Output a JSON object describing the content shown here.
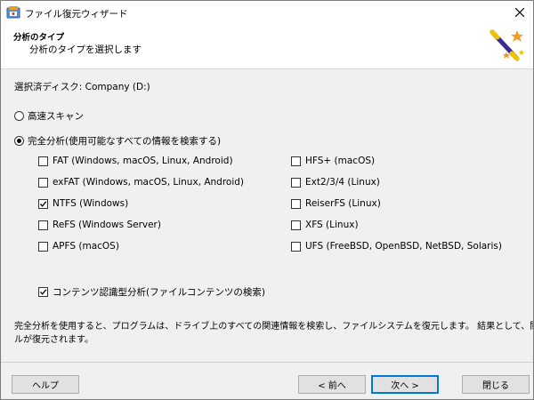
{
  "window": {
    "title": "ファイル復元ウィザード"
  },
  "header": {
    "title": "分析のタイプ",
    "subtitle": "分析のタイプを選択します"
  },
  "selected_disk": "選択済ディスク: Company (D:)",
  "options": {
    "quick_scan": {
      "label": "高速スキャン",
      "checked": false
    },
    "full_analysis": {
      "label": "完全分析(使用可能なすべての情報を検索する)",
      "checked": true
    }
  },
  "filesystems_left": [
    {
      "label": "FAT (Windows, macOS, Linux, Android)",
      "checked": false
    },
    {
      "label": "exFAT (Windows, macOS, Linux, Android)",
      "checked": false
    },
    {
      "label": "NTFS (Windows)",
      "checked": true
    },
    {
      "label": "ReFS (Windows Server)",
      "checked": false
    },
    {
      "label": "APFS (macOS)",
      "checked": false
    }
  ],
  "filesystems_right": [
    {
      "label": "HFS+ (macOS)",
      "checked": false
    },
    {
      "label": "Ext2/3/4 (Linux)",
      "checked": false
    },
    {
      "label": "ReiserFS (Linux)",
      "checked": false
    },
    {
      "label": "XFS (Linux)",
      "checked": false
    },
    {
      "label": "UFS (FreeBSD, OpenBSD, NetBSD, Solaris)",
      "checked": false
    }
  ],
  "content_analysis": {
    "label": "コンテンツ認識型分析(ファイルコンテンツの検索)",
    "checked": true
  },
  "description": {
    "line1": "完全分析を使用すると、プログラムは、ドライブ上のすべての関連情報を検索し、ファイルシステムを復元します。 結果として、関連するすべてのファイ",
    "line2": "ルが復元されます。"
  },
  "buttons": {
    "help": "ヘルプ",
    "back": "< 前へ",
    "next": "次へ >",
    "close": "閉じる"
  },
  "colors": {
    "accent": "#0078d7",
    "dialog_bg": "#f0f0f0"
  }
}
